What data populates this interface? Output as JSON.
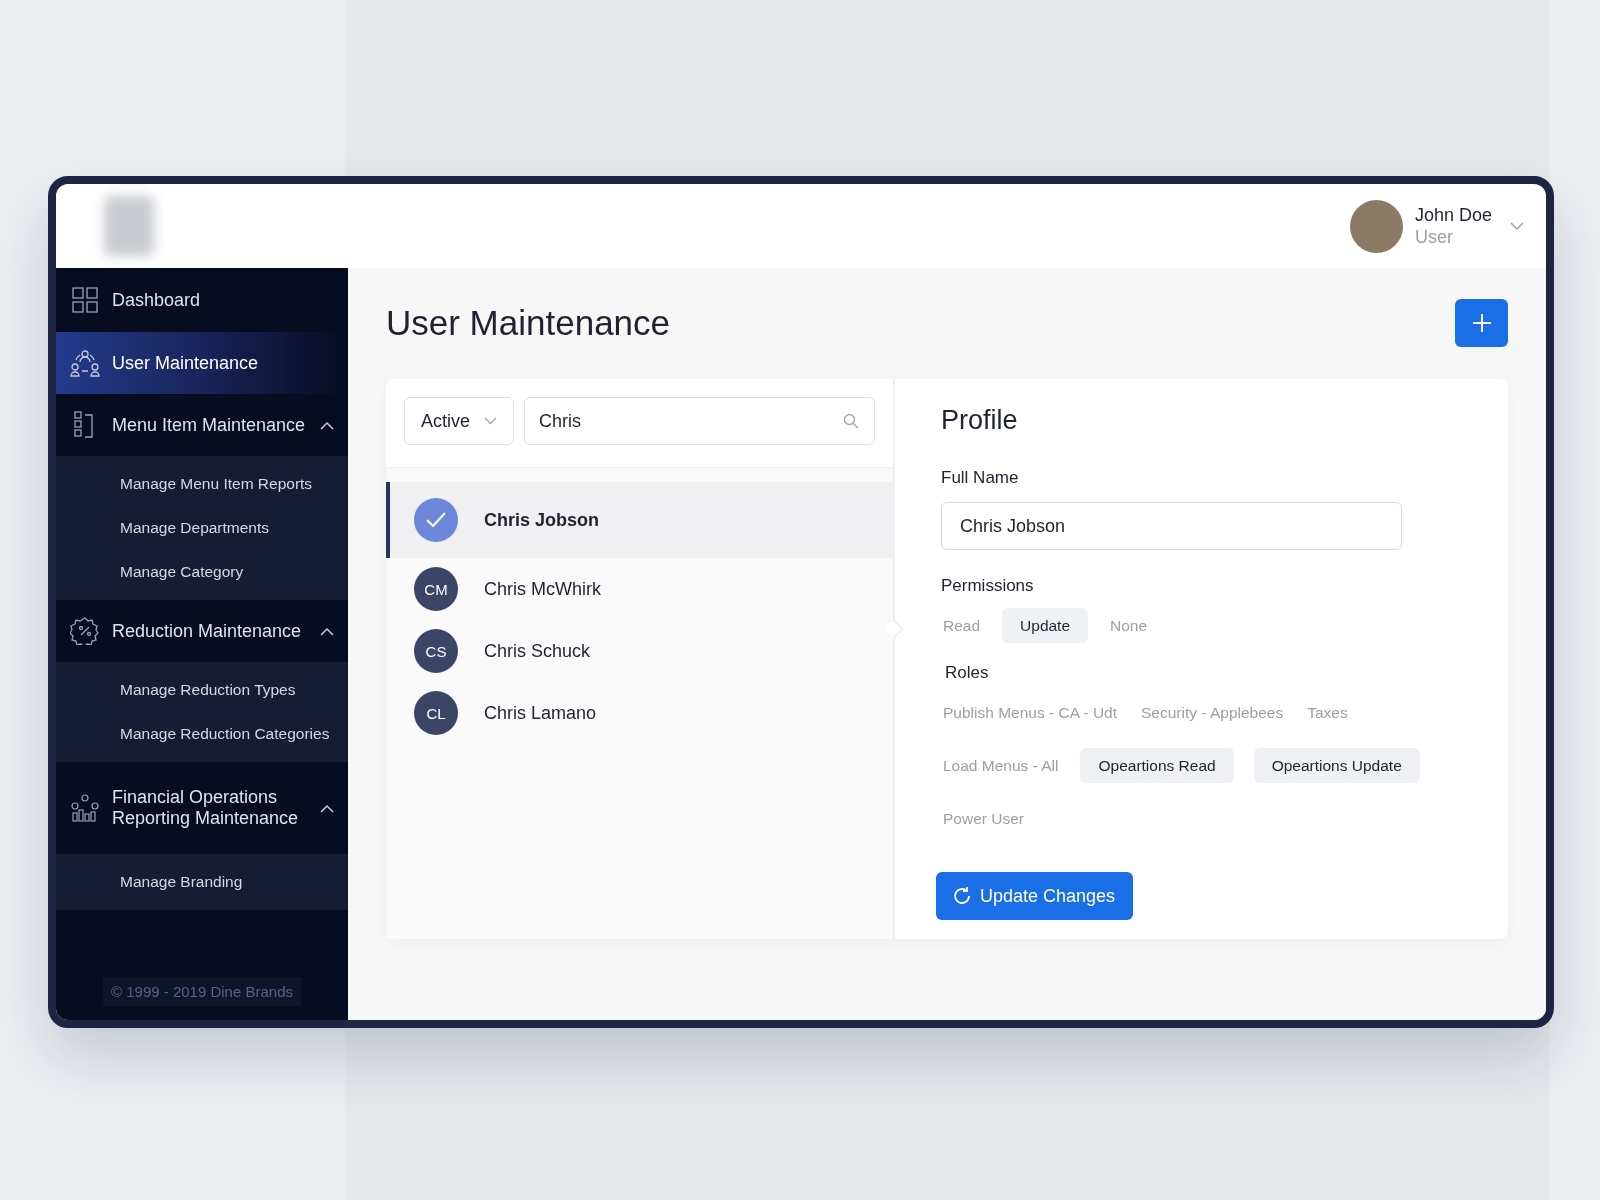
{
  "header": {
    "user": {
      "name": "John Doe",
      "role": "User"
    }
  },
  "sidebar": {
    "items": [
      {
        "label": "Dashboard",
        "selected": false
      },
      {
        "label": "User Maintenance",
        "selected": true
      },
      {
        "label": "Menu Item Maintenance",
        "selected": false,
        "expanded": true,
        "children": [
          {
            "label": "Manage Menu Item Reports",
            "selected": false
          },
          {
            "label": "Manage Departments",
            "selected": false
          },
          {
            "label": "Manage Category",
            "selected": false
          }
        ]
      },
      {
        "label": "Reduction Maintenance",
        "selected": false,
        "expanded": true,
        "children": [
          {
            "label": "Manage Reduction Types",
            "selected": false
          },
          {
            "label": "Manage Reduction Categories",
            "selected": false
          }
        ]
      },
      {
        "label": "Financial Operations Reporting Maintenance",
        "selected": false,
        "expanded": true,
        "children": [
          {
            "label": "Manage Branding",
            "selected": false
          }
        ]
      }
    ],
    "footer": "© 1999 - 2019 Dine Brands"
  },
  "page": {
    "title": "User Maintenance"
  },
  "filter": {
    "status": "Active",
    "search": "Chris"
  },
  "users": [
    {
      "name": "Chris Jobson",
      "selected": true
    },
    {
      "name": "Chris McWhirk",
      "initials": "CM",
      "selected": false
    },
    {
      "name": "Chris Schuck",
      "initials": "CS",
      "selected": false
    },
    {
      "name": "Chris Lamano",
      "initials": "CL",
      "selected": false
    }
  ],
  "profile": {
    "title": "Profile",
    "full_name_label": "Full Name",
    "full_name": "Chris Jobson",
    "permissions_label": "Permissions",
    "permissions": [
      {
        "label": "Read",
        "selected": false
      },
      {
        "label": "Update",
        "selected": true
      },
      {
        "label": "None",
        "selected": false
      }
    ],
    "roles_label": "Roles",
    "roles": [
      {
        "label": "Publish Menus - CA - Udt",
        "selected": false
      },
      {
        "label": "Security - Applebees",
        "selected": false
      },
      {
        "label": "Taxes",
        "selected": false
      },
      {
        "label": "Load Menus - All",
        "selected": false
      },
      {
        "label": "Opeartions Read",
        "selected": true
      },
      {
        "label": "Opeartions Update",
        "selected": true
      },
      {
        "label": "Power User",
        "selected": false
      }
    ],
    "update_button": "Update Changes"
  }
}
